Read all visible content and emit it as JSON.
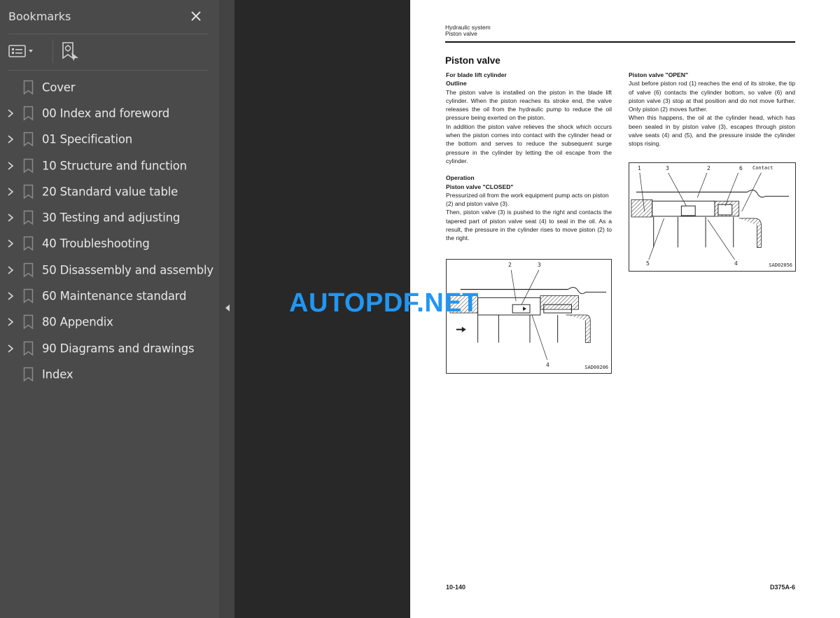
{
  "sidebar": {
    "title": "Bookmarks",
    "close_icon": "close-icon",
    "toolbar": {
      "options_icon": "list-options-icon",
      "find_icon": "find-current-bookmark-icon"
    },
    "items": [
      {
        "label": "Cover",
        "expandable": false
      },
      {
        "label": "00 Index and foreword",
        "expandable": true
      },
      {
        "label": "01 Specification",
        "expandable": true
      },
      {
        "label": "10 Structure and function",
        "expandable": true
      },
      {
        "label": "20 Standard value table",
        "expandable": true
      },
      {
        "label": "30 Testing and adjusting",
        "expandable": true
      },
      {
        "label": "40 Troubleshooting",
        "expandable": true
      },
      {
        "label": "50 Disassembly and assembly",
        "expandable": true
      },
      {
        "label": "60 Maintenance standard",
        "expandable": true
      },
      {
        "label": "80 Appendix",
        "expandable": true
      },
      {
        "label": "90 Diagrams and drawings",
        "expandable": true
      },
      {
        "label": "Index",
        "expandable": false
      }
    ]
  },
  "splitter": {
    "toggle_icon": "collapse-left-icon"
  },
  "watermark": "AUTOPDF.NET",
  "page": {
    "header_line1": "Hydraulic system",
    "header_line2": "Piston valve",
    "title": "Piston valve",
    "left": {
      "subtitle": "For blade lift cylinder",
      "outline_heading": "Outline",
      "outline_p1": "The piston valve is installed on the piston in the blade lift cylinder. When the piston reaches its stroke end, the valve releases the oil from the hydraulic pump to reduce the oil pressure being exerted on the piston.",
      "outline_p2": "In addition the piston valve relieves the shock which occurs when the piston comes into contact with the cylinder head or the bottom and serves to reduce the subsequent surge pressure in the cylinder by letting the oil escape from the cylinder.",
      "operation_heading": "Operation",
      "closed_heading": "Piston valve \"CLOSED\"",
      "closed_p1": "Pressurized oil from the work equipment pump acts on piston (2) and piston valve (3).",
      "closed_p2": "Then, piston valve (3) is pushed to the right and contacts the tapered part of piston valve seat (4) to seal in the oil. As a result, the pressure in the cylinder rises to move piston (2) to the right."
    },
    "right": {
      "open_heading": "Piston valve \"OPEN\"",
      "open_p1": "Just before piston rod (1) reaches the end of its stroke, the tip of valve (6) contacts the cylinder bottom, so valve (6) and piston valve (3) stop at that position and do not move further. Only piston (2) moves further.",
      "open_p2": "When this happens, the oil at the cylinder head, which has been sealed in by piston valve (3), escapes through piston valve seats (4) and (5), and the pressure inside the cylinder stops rising."
    },
    "figure_closed": {
      "code": "SAD00206",
      "labels": [
        "2",
        "3",
        "4"
      ]
    },
    "figure_open": {
      "code": "SAD02056",
      "labels": [
        "1",
        "3",
        "2",
        "6",
        "Contact",
        "5",
        "4"
      ]
    },
    "footer_left": "10-140",
    "footer_right": "D375A-6"
  }
}
